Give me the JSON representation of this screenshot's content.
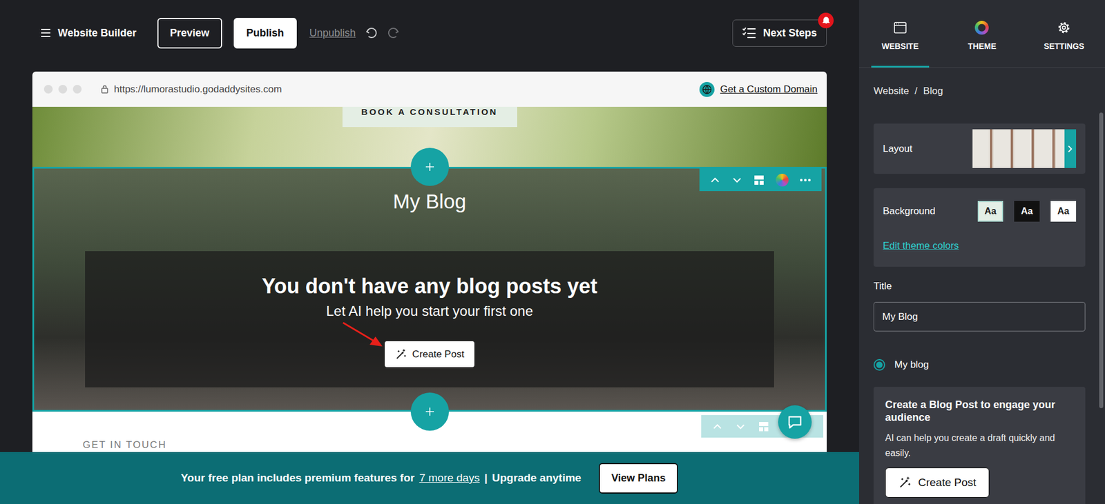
{
  "topbar": {
    "title": "Website Builder",
    "preview": "Preview",
    "publish": "Publish",
    "unpublish": "Unpublish",
    "unpublish_disabled": true,
    "undo_disabled": false,
    "redo_disabled": true,
    "next_steps": "Next Steps",
    "has_notification": true
  },
  "browser": {
    "url": "https://lumorastudio.godaddysites.com",
    "custom_domain": "Get a Custom Domain"
  },
  "hero": {
    "button": "BOOK A CONSULTATION"
  },
  "blog": {
    "title": "My Blog",
    "selected": true,
    "empty_title": "You don't have any blog posts yet",
    "empty_subtitle": "Let AI help you start your first one",
    "button": "Create Post"
  },
  "contact": {
    "heading": "GET IN TOUCH"
  },
  "banner": {
    "before": "Your free plan includes premium features for",
    "link": "7 more days",
    "separator": "|",
    "after": "Upgrade anytime",
    "button": "View Plans"
  },
  "panel": {
    "tabs": [
      {
        "label": "WEBSITE",
        "selected": true
      },
      {
        "label": "THEME",
        "selected": false
      },
      {
        "label": "SETTINGS",
        "selected": false
      }
    ],
    "breadcrumb": [
      "Website",
      "/",
      "Blog"
    ],
    "layout": {
      "label": "Layout"
    },
    "background": {
      "label": "Background",
      "swatches": [
        {
          "label": "Aa",
          "color": "#e3efe6",
          "selected": true
        },
        {
          "label": "Aa",
          "color": "#111111",
          "selected": false
        },
        {
          "label": "Aa",
          "color": "#ffffff",
          "selected": false
        }
      ],
      "link": "Edit theme colors"
    },
    "title_field": {
      "label": "Title",
      "value": "My Blog"
    },
    "options": [
      {
        "label": "My blog",
        "selected": true
      }
    ],
    "promo": {
      "title": "Create a Blog Post to engage your audience",
      "body": "AI can help you create a draft quickly and easily.",
      "button": "Create Post"
    }
  }
}
